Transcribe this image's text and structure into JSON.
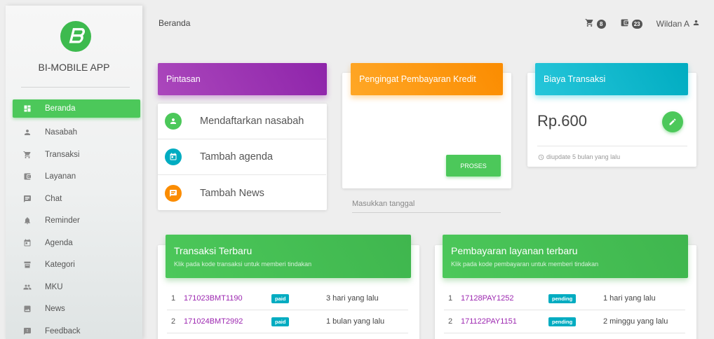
{
  "sidebar": {
    "app_name": "BI-MOBILE APP",
    "items": [
      {
        "label": "Beranda",
        "icon": "dashboard-icon"
      },
      {
        "label": "Nasabah",
        "icon": "person-icon"
      },
      {
        "label": "Transaksi",
        "icon": "cart-icon"
      },
      {
        "label": "Layanan",
        "icon": "wallet-icon"
      },
      {
        "label": "Chat",
        "icon": "chat-icon"
      },
      {
        "label": "Reminder",
        "icon": "bell-icon"
      },
      {
        "label": "Agenda",
        "icon": "calendar-icon"
      },
      {
        "label": "Kategori",
        "icon": "category-icon"
      },
      {
        "label": "MKU",
        "icon": "group-icon"
      },
      {
        "label": "News",
        "icon": "image-icon"
      },
      {
        "label": "Feedback",
        "icon": "feedback-icon"
      }
    ],
    "active_index": 0
  },
  "header": {
    "breadcrumb": "Beranda",
    "cart_count": "8",
    "wallet_count": "23",
    "user_name": "Wildan A"
  },
  "shortcuts": {
    "title": "Pintasan",
    "items": [
      {
        "label": "Mendaftarkan nasabah",
        "icon": "person-icon",
        "color": "#4cc85a"
      },
      {
        "label": "Tambah agenda",
        "icon": "calendar-icon",
        "color": "#00acc1"
      },
      {
        "label": "Tambah News",
        "icon": "chat-icon",
        "color": "#fb8c00"
      }
    ]
  },
  "credit_reminder": {
    "title": "Pengingat Pembayaran Kredit",
    "date_placeholder": "Masukkan tanggal",
    "button_label": "PROSES"
  },
  "transaction_fee": {
    "title": "Biaya Transaksi",
    "amount": "Rp.600",
    "updated": "diupdate 5 bulan yang lalu"
  },
  "recent_transactions": {
    "title": "Transaksi Terbaru",
    "subtitle": "Klik pada kode transaksi untuk memberi tindakan",
    "rows": [
      {
        "no": "1",
        "code": "171023BMT1190",
        "status": "paid",
        "time": "3 hari yang lalu"
      },
      {
        "no": "2",
        "code": "171024BMT2992",
        "status": "paid",
        "time": "1 bulan yang lalu"
      }
    ]
  },
  "recent_payments": {
    "title": "Pembayaran layanan terbaru",
    "subtitle": "Klik pada kode pembayaran untuk memberi tindakan",
    "rows": [
      {
        "no": "1",
        "code": "17128PAY1252",
        "status": "pending",
        "time": "1 hari yang lalu"
      },
      {
        "no": "2",
        "code": "171122PAY1151",
        "status": "pending",
        "time": "2 minggu yang lalu"
      }
    ]
  },
  "colors": {
    "accent_green": "#4cc85a",
    "purple": "#9c27b0",
    "orange": "#fb8c00",
    "cyan": "#00acc1"
  }
}
